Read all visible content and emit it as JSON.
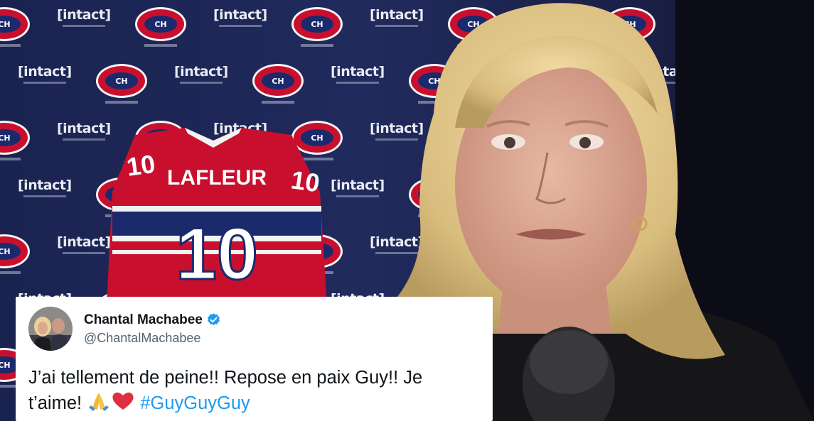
{
  "scene": {
    "jersey": {
      "name": "LAFLEUR",
      "number": "10",
      "sleeve_number": "10"
    },
    "backdrop_logos": {
      "team_logo": "CH",
      "sponsor": "[intact]"
    }
  },
  "tweet": {
    "display_name": "Chantal Machabee",
    "handle": "@ChantalMachabee",
    "verified": true,
    "text_part1": "J’ai tellement de peine!! Repose en paix Guy!! Je t’aime! ",
    "emoji_1": "praying-hands",
    "emoji_2": "red-heart",
    "hashtag": "#GuyGuyGuy"
  },
  "colors": {
    "backdrop": "#1c2452",
    "canadiens_red": "#c8102e",
    "canadiens_blue": "#1a2a6c",
    "twitter_blue": "#1d9bf0",
    "text_primary": "#0f1419",
    "text_secondary": "#536471"
  }
}
